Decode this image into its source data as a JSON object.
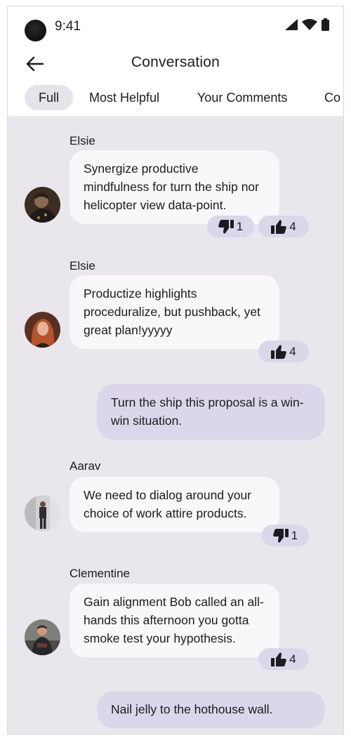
{
  "status_bar": {
    "time": "9:41",
    "icons": [
      "signal-icon",
      "wifi-icon",
      "battery-icon"
    ]
  },
  "top_bar": {
    "back_icon": "arrow-back-icon",
    "title": "Conversation"
  },
  "tabs": [
    {
      "label": "Full",
      "selected": true
    },
    {
      "label": "Most Helpful",
      "selected": false
    },
    {
      "label": "Your Comments",
      "selected": false
    },
    {
      "label": "Co",
      "selected": false
    }
  ],
  "messages": [
    {
      "sender": "Elsie",
      "text": "Synergize productive mindfulness for turn the ship nor helicopter view data-point.",
      "reactions": {
        "thumbs_down": "1",
        "thumbs_up": "4"
      }
    },
    {
      "sender": "Elsie",
      "text": "Productize highlights proceduralize, but pushback, yet great plan!yyyyy",
      "reactions": {
        "thumbs_up": "4"
      }
    },
    {
      "own": true,
      "text": "Turn the ship this proposal is a win-win situation."
    },
    {
      "sender": "Aarav",
      "text": "We need to dialog around your choice of work attire products.",
      "reactions": {
        "thumbs_down": "1"
      }
    },
    {
      "sender": "Clementine",
      "text": "Gain alignment Bob called an all-hands this afternoon you gotta smoke test your hypothesis.",
      "reactions": {
        "thumbs_up": "4"
      }
    },
    {
      "own": true,
      "text": "Nail jelly to the hothouse wall."
    }
  ],
  "colors": {
    "chat_background": "#e9e6ec",
    "incoming_bubble": "#f8f7f9",
    "outgoing_bubble": "#dcd6ea",
    "reaction_chip": "#dcd6ea",
    "active_tab": "#e7e3ea"
  }
}
